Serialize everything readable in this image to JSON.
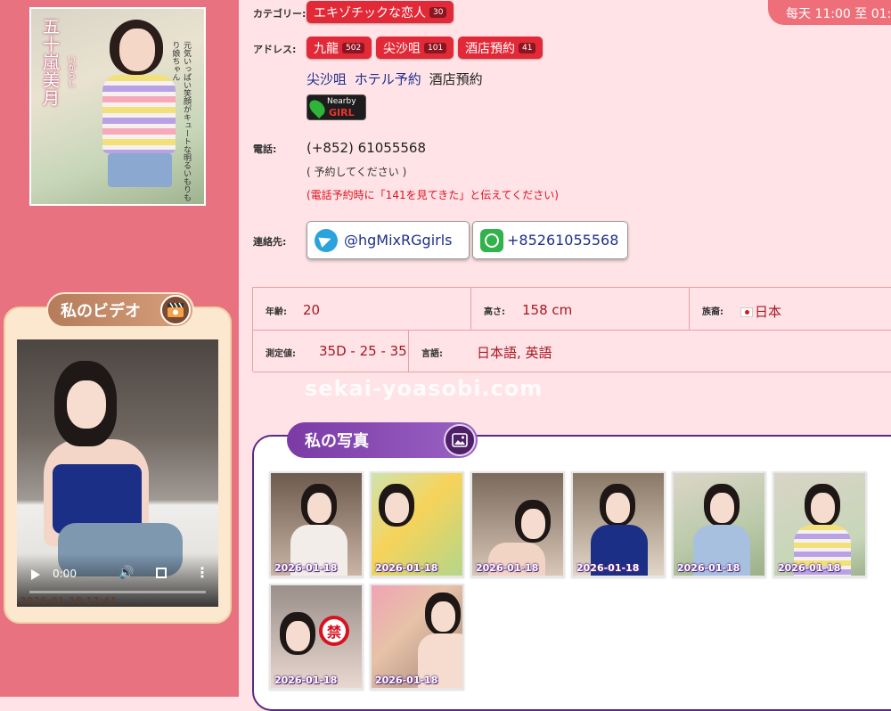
{
  "profile": {
    "name_vertical": "五十嵐美月",
    "name_kana": "いがらし",
    "photo_quote": "元気いっぱい笑顔がキュートな明るいもりもり娘ちゃん"
  },
  "hours": "每天 11:00 至 01:00",
  "category": {
    "label": "カテゴリー:",
    "tag": "エキゾチックな恋人",
    "count": "30"
  },
  "address": {
    "label": "アドレス:",
    "tags": [
      {
        "name": "九龍",
        "count": "502"
      },
      {
        "name": "尖沙咀",
        "count": "101"
      },
      {
        "name": "酒店預約",
        "count": "41"
      }
    ],
    "links": [
      "尖沙咀",
      "ホテル予約",
      "酒店預約"
    ]
  },
  "nearby_badge": {
    "line1": "Nearby",
    "line2": "GIRL"
  },
  "phone": {
    "label": "電話:",
    "number": "(+852) 61055568",
    "note": "( 予約してください )",
    "warning": "(電話予約時に「141を見てきた」と伝えてください)"
  },
  "contact": {
    "label": "連絡先:",
    "telegram": "@hgMixRGgirls",
    "whatsapp": "+85261055568"
  },
  "stats": {
    "age_label": "年齢:",
    "age": "20",
    "height_label": "高さ:",
    "height": "158 cm",
    "ethnicity_label": "族裔:",
    "ethnicity": "日本",
    "measurements_label": "測定値:",
    "measurements": "35D - 25 - 35",
    "language_label": "言語:",
    "languages": "日本語, 英語"
  },
  "watermark": "sekai-yoasobi.com",
  "video": {
    "title": "私のビデオ",
    "time": "0:00",
    "date": "2026-01-18 17:41",
    "progress": 0.0
  },
  "photos": {
    "title": "私の写真",
    "items": [
      {
        "date": "2026-01-18"
      },
      {
        "date": "2026-01-18"
      },
      {
        "date": "2026-01-18"
      },
      {
        "date": "2026-01-18"
      },
      {
        "date": "2026-01-18"
      },
      {
        "date": "2026-01-18"
      },
      {
        "date": "2026-01-18"
      },
      {
        "date": "2026-01-18"
      }
    ],
    "ban_mark": "禁"
  },
  "colors": {
    "sidebar": "#e8727f",
    "tag_red": "#e22937",
    "purple": "#7b3aa5",
    "value_red": "#a61724"
  }
}
